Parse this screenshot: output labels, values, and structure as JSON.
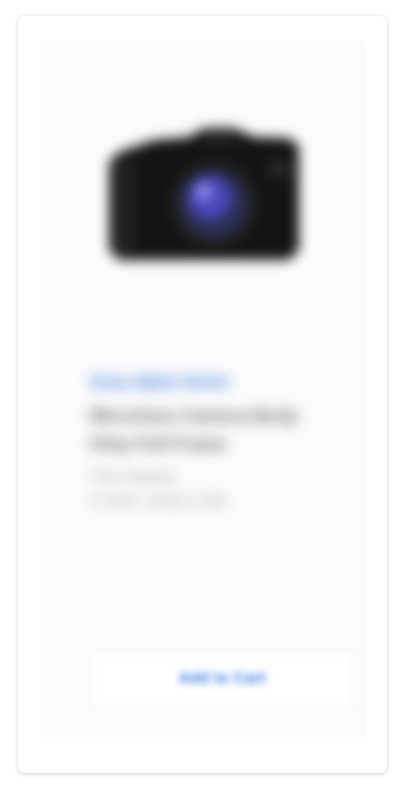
{
  "product": {
    "image_icon": "camera-icon",
    "brand": "Sony Alpha Series",
    "title": "Mirrorless Camera Body Only Full Frame",
    "meta_1": "Free shipping",
    "meta_2": "In stock, ready to ship"
  },
  "actions": {
    "primary_label": "Add to Cart"
  }
}
